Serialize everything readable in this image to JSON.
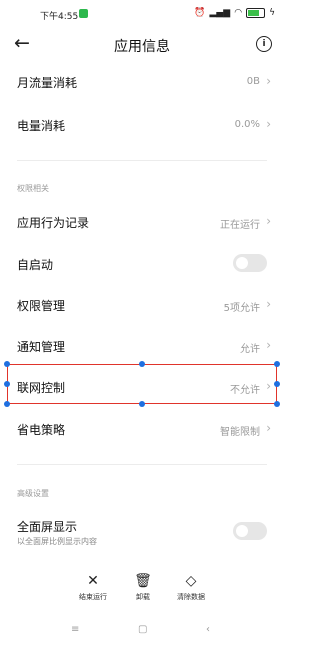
{
  "status_bar": {
    "time": "下午4:55",
    "icons": [
      "alarm-icon",
      "signal-icon",
      "wifi-icon",
      "battery-icon",
      "charging-icon"
    ]
  },
  "header": {
    "title": "应用信息"
  },
  "rows": {
    "data_usage": {
      "label": "月流量消耗",
      "value": "0B"
    },
    "battery_usage": {
      "label": "电量消耗",
      "value": "0.0%"
    },
    "behavior_log": {
      "label": "应用行为记录",
      "value": "正在运行"
    },
    "autostart": {
      "label": "自启动"
    },
    "permission_manage": {
      "label": "权限管理",
      "value": "5项允许"
    },
    "notification_manage": {
      "label": "通知管理",
      "value": "允许"
    },
    "network_control": {
      "label": "联网控制",
      "value": "不允许"
    },
    "power_strategy": {
      "label": "省电策略",
      "value": "智能限制"
    },
    "fullscreen": {
      "label": "全面屏显示",
      "sub": "以全面屏比例显示内容"
    }
  },
  "sections": {
    "permissions": "权限相关",
    "advanced": "高级设置"
  },
  "bottom_actions": {
    "force_stop": "结束运行",
    "uninstall": "卸载",
    "clear_data": "清除数据"
  }
}
